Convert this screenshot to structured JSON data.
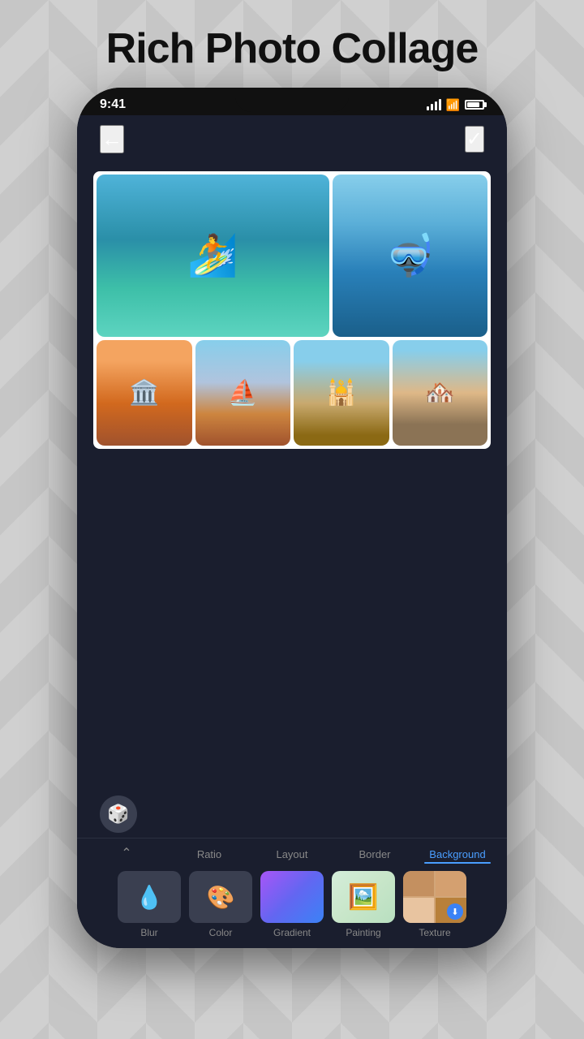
{
  "app": {
    "title": "Rich Photo Collage"
  },
  "status_bar": {
    "time": "9:41",
    "signal": "signal",
    "wifi": "wifi",
    "battery": "battery"
  },
  "header": {
    "back_label": "←",
    "check_label": "✓"
  },
  "collage": {
    "photos": [
      {
        "id": "surf",
        "alt": "Windsurfer on ocean"
      },
      {
        "id": "snorkel",
        "alt": "Snorkeler underwater"
      },
      {
        "id": "venice1",
        "alt": "Venice buildings"
      },
      {
        "id": "venice2",
        "alt": "Venice canal"
      },
      {
        "id": "venice3",
        "alt": "Venice dome"
      },
      {
        "id": "venice4",
        "alt": "Venice waterfront"
      }
    ]
  },
  "dice_button": {
    "label": "🎲"
  },
  "tabs": [
    {
      "id": "collapse",
      "label": "",
      "icon": "chevron-down",
      "active": false
    },
    {
      "id": "ratio",
      "label": "Ratio",
      "active": false
    },
    {
      "id": "layout",
      "label": "Layout",
      "active": false
    },
    {
      "id": "border",
      "label": "Border",
      "active": false
    },
    {
      "id": "background",
      "label": "Background",
      "active": true
    }
  ],
  "background_options": [
    {
      "id": "blur",
      "label": "Blur",
      "icon": "💧"
    },
    {
      "id": "color",
      "label": "Color",
      "icon": "🎨"
    },
    {
      "id": "gradient",
      "label": "Gradient",
      "icon": "gradient"
    },
    {
      "id": "painting",
      "label": "Painting",
      "icon": "painting"
    },
    {
      "id": "texture",
      "label": "Texture",
      "icon": "texture",
      "has_download": true
    }
  ]
}
